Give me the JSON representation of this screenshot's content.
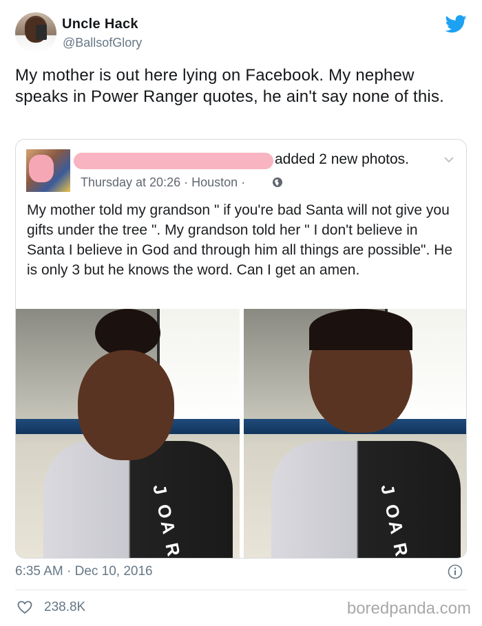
{
  "tweet": {
    "display_name": "Uncle Hack",
    "handle": "@BallsofGlory",
    "text": "My mother is out here lying on Facebook. My nephew speaks in Power Ranger quotes, he ain't say none of this.",
    "timestamp": "6:35 AM · Dec 10, 2016",
    "likes": "238.8K"
  },
  "facebook_post": {
    "action": "added 2 new photos.",
    "meta": "Thursday at 20:26 · Houston ·",
    "text": "My mother told my grandson \" if you're bad Santa will not give you gifts under the tree \". My grandson told her \" I don't believe in Santa I believe in God and through   him all things are possible\". He is only 3 but he knows the word. Can I get an amen.",
    "photo_shirt_text": [
      "J OA R·D",
      "J OA R·D"
    ]
  },
  "watermark": "boredpanda.com",
  "colors": {
    "twitter_blue": "#1da1f2",
    "redaction_pink": "#f8b4c0",
    "meta_gray": "#657786"
  },
  "icons": [
    "twitter-bird-icon",
    "chevron-down-icon",
    "globe-icon",
    "info-icon",
    "heart-icon"
  ]
}
